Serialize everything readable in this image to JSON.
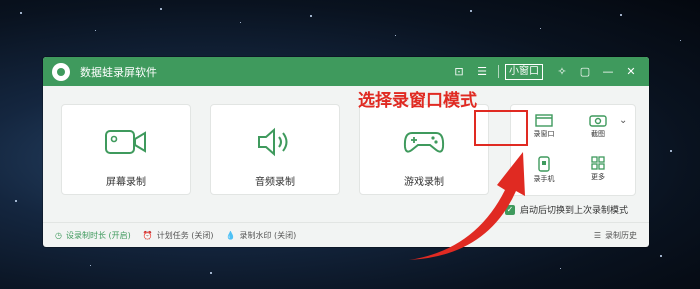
{
  "app": {
    "title": "数据蛙录屏软件",
    "mini_label": "小窗口",
    "accent": "#3f9a5d"
  },
  "annotation": {
    "text": "选择录窗口模式",
    "color": "#e02a22"
  },
  "cards": [
    {
      "label": "屏幕录制",
      "icon": "camera-icon"
    },
    {
      "label": "音频录制",
      "icon": "speaker-icon"
    },
    {
      "label": "游戏录制",
      "icon": "gamepad-icon"
    }
  ],
  "side_panel": {
    "record_window": "录窗口",
    "screenshot": "截图",
    "record_phone": "录手机",
    "more": "更多"
  },
  "auto_switch": "启动后切换到上次录制模式",
  "footer": {
    "duration": "设录制时长 (开启)",
    "schedule": "计划任务 (关闭)",
    "watermark": "录制水印 (关闭)",
    "history": "录制历史"
  }
}
